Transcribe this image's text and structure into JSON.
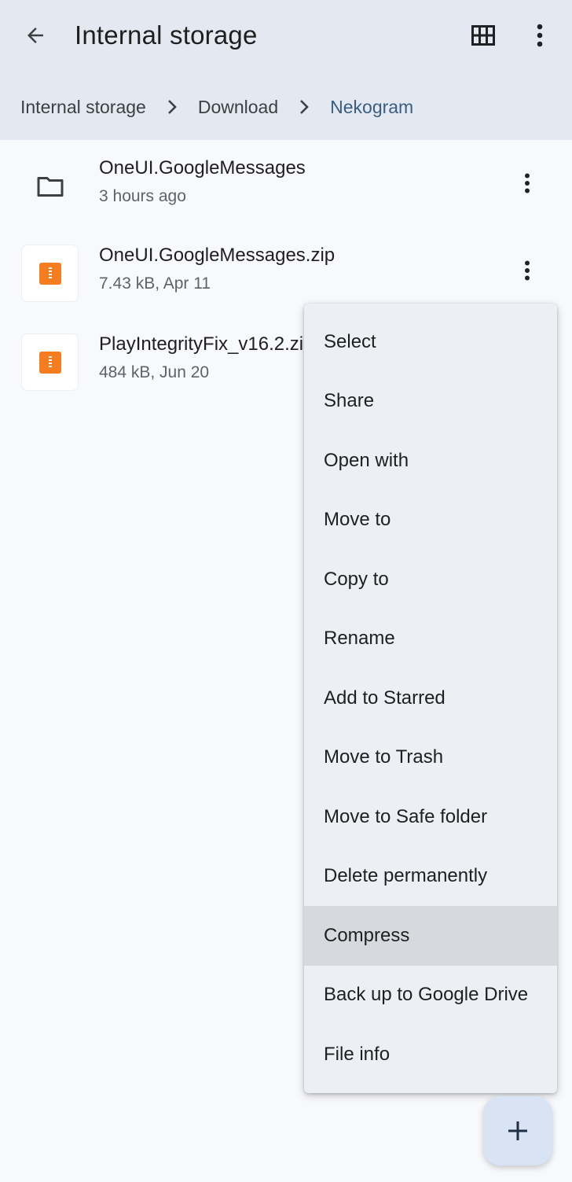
{
  "header": {
    "title": "Internal storage",
    "back_icon": "arrow-back-icon",
    "grid_icon": "grid-view-icon",
    "more_icon": "more-vert-icon"
  },
  "breadcrumb": {
    "items": [
      "Internal storage",
      "Download",
      "Nekogram"
    ]
  },
  "files": [
    {
      "name": "OneUI.GoogleMessages",
      "meta": "3 hours ago",
      "icon": "folder-icon"
    },
    {
      "name": "OneUI.GoogleMessages.zip",
      "meta": "7.43 kB, Apr 11",
      "icon": "zip-icon"
    },
    {
      "name": "PlayIntegrityFix_v16.2.zip",
      "meta": "484 kB, Jun 20",
      "icon": "zip-icon"
    }
  ],
  "menu": {
    "items": [
      "Select",
      "Share",
      "Open with",
      "Move to",
      "Copy to",
      "Rename",
      "Add to Starred",
      "Move to Trash",
      "Move to Safe folder",
      "Delete permanently",
      "Compress",
      "Back up to Google Drive",
      "File info"
    ],
    "highlighted": "Compress"
  },
  "fab": {
    "icon": "add-icon"
  },
  "colors": {
    "topbar": "#e4e9f1",
    "active_crumb": "#3a5d80",
    "zip": "#f57c1f",
    "fab": "#d8e3f4"
  }
}
